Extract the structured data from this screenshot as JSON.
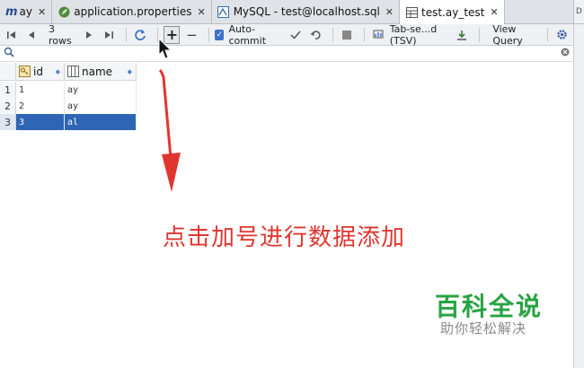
{
  "tabs": [
    {
      "label": "ay",
      "icon": "m-logo-icon",
      "active": false
    },
    {
      "label": "application.properties",
      "icon": "leaf-icon",
      "active": false
    },
    {
      "label": "MySQL - test@localhost.sql",
      "icon": "sql-file-icon",
      "active": false
    },
    {
      "label": "test.ay_test",
      "icon": "table-icon",
      "active": true
    }
  ],
  "toolbar": {
    "rows_label": "3 rows",
    "plus_label": "+",
    "minus_label": "−",
    "autocommit_label": "Auto-commit",
    "export_format_label": "Tab-se...d (TSV)",
    "view_query_label": "View Query"
  },
  "grid": {
    "columns": [
      {
        "label": "id",
        "icon": "key-column-icon"
      },
      {
        "label": "name",
        "icon": "column-icon"
      }
    ],
    "rows": [
      {
        "num": "1",
        "id": "1",
        "name": "ay",
        "selected": false
      },
      {
        "num": "2",
        "id": "2",
        "name": "ay",
        "selected": false
      },
      {
        "num": "3",
        "id": "3",
        "name": "al",
        "selected": true
      }
    ]
  },
  "annotation": {
    "text": "点击加号进行数据添加",
    "color": "#e0362f"
  },
  "watermark": {
    "title": "百科全说",
    "subtitle": "助你轻松解决",
    "color": "#27a342"
  },
  "colors": {
    "selection": "#2f65b5",
    "accent_blue": "#3b73c8"
  }
}
